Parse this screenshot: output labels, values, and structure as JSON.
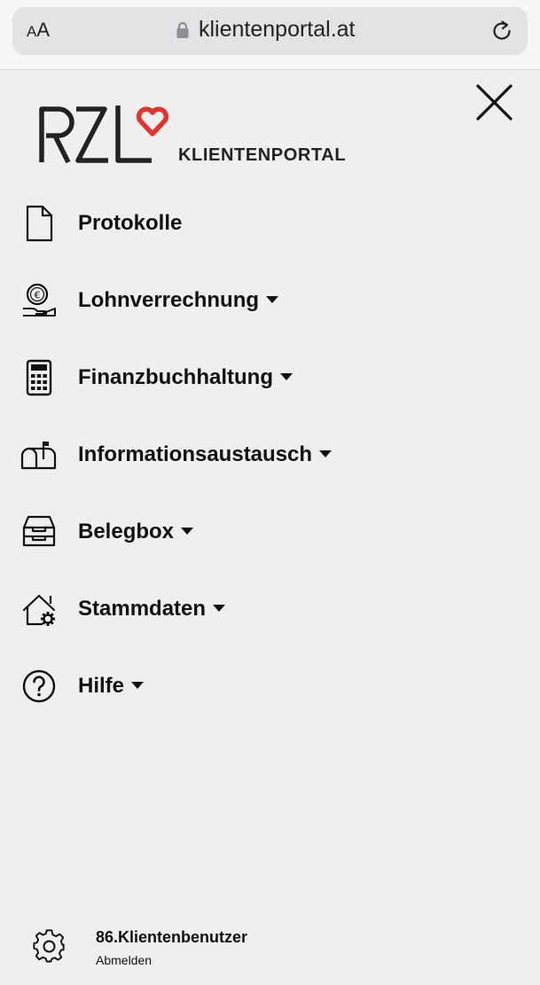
{
  "browser": {
    "text_size_small": "A",
    "text_size_large": "A",
    "url": "klientenportal.at"
  },
  "logo": {
    "brand": "RZL",
    "subtitle": "KLIENTENPORTAL",
    "heart_color": "#e0342f"
  },
  "menu": {
    "items": [
      {
        "label": "Protokolle",
        "icon": "document-icon",
        "has_dropdown": false
      },
      {
        "label": "Lohnverrechnung",
        "icon": "euro-coin-hand-icon",
        "has_dropdown": true
      },
      {
        "label": "Finanzbuchhaltung",
        "icon": "calculator-icon",
        "has_dropdown": true
      },
      {
        "label": "Informationsaustausch",
        "icon": "mailbox-icon",
        "has_dropdown": true
      },
      {
        "label": "Belegbox",
        "icon": "inbox-tray-icon",
        "has_dropdown": true
      },
      {
        "label": "Stammdaten",
        "icon": "house-gear-icon",
        "has_dropdown": true
      },
      {
        "label": "Hilfe",
        "icon": "question-circle-icon",
        "has_dropdown": true
      }
    ]
  },
  "footer": {
    "username": "86.Klientenbenutzer",
    "logout_label": "Abmelden"
  },
  "colors": {
    "background": "#efefef",
    "text": "#111111",
    "accent": "#e0342f"
  }
}
